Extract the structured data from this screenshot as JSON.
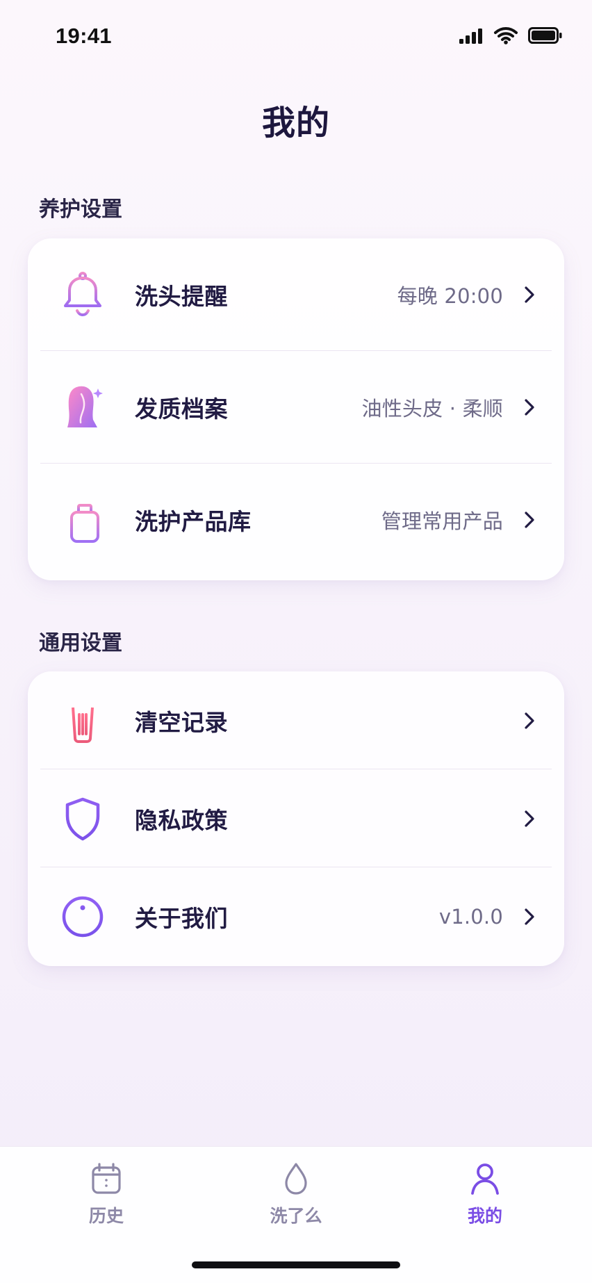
{
  "status_bar": {
    "time": "19:41",
    "icons": [
      "signal-icon",
      "wifi-icon",
      "battery-icon"
    ]
  },
  "page": {
    "title": "我的"
  },
  "sections": {
    "care": {
      "title": "养护设置",
      "items": [
        {
          "icon": "bell-icon",
          "label": "洗头提醒",
          "value": "每晚 20:00"
        },
        {
          "icon": "hair-profile-icon",
          "label": "发质档案",
          "value": "油性头皮 · 柔顺"
        },
        {
          "icon": "product-bottle-icon",
          "label": "洗护产品库",
          "value": "管理常用产品"
        }
      ]
    },
    "general": {
      "title": "通用设置",
      "items": [
        {
          "icon": "trash-icon",
          "label": "清空记录",
          "value": ""
        },
        {
          "icon": "shield-icon",
          "label": "隐私政策",
          "value": ""
        },
        {
          "icon": "info-icon",
          "label": "关于我们",
          "value": "v1.0.0"
        }
      ]
    }
  },
  "tabbar": {
    "tabs": [
      {
        "icon": "calendar-icon",
        "label": "历史",
        "active": false
      },
      {
        "icon": "drop-icon",
        "label": "洗了么",
        "active": false
      },
      {
        "icon": "user-icon",
        "label": "我的",
        "active": true
      }
    ]
  },
  "colors": {
    "accent": "#7a4de5",
    "text_primary": "#211b43",
    "text_secondary": "#6e6a88",
    "danger": "#ef5a7b"
  }
}
